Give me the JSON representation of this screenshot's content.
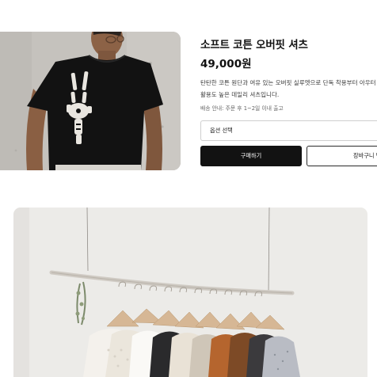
{
  "product": {
    "title": "소프트 코튼 오버핏 셔츠",
    "price": "49,000원",
    "description_lines": [
      "탄탄한 코튼 원단과 여유 있는 오버핏 실루엣으로 단독 착용부터 아우터",
      "활용도 높은 데일리 셔츠입니다."
    ],
    "shipping_note": "배송 안내: 주문 후 1~2일 이내 출고"
  },
  "option_select": {
    "label": "옵션 선택"
  },
  "actions": {
    "buy_label": "구매하기",
    "cart_label": "장바구니 담기"
  },
  "images": {
    "hero_icon": "product-photo-icon",
    "rack_icon": "clothing-rack-photo-icon"
  },
  "colors": {
    "primary_button": "#121212",
    "primary_text": "#ffffff",
    "border": "#cfcfcf"
  }
}
